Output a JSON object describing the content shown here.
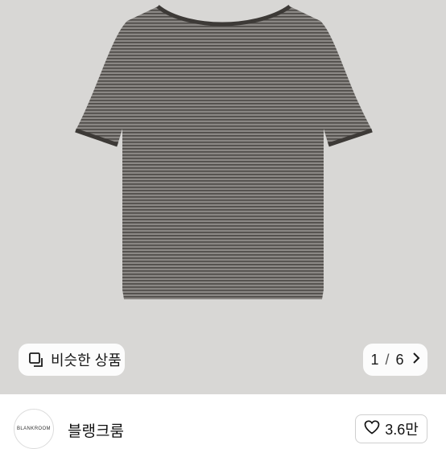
{
  "gallery": {
    "similar_label": "비슷한 상품",
    "similar_icon": "similar-items-icon",
    "current_page": "1",
    "separator": "/",
    "total_pages": "6",
    "next_icon": "chevron-right-icon"
  },
  "seller": {
    "logo_text": "BLANKROOM",
    "name": "블랭크룸",
    "likes": "3.6만",
    "like_icon": "heart-icon"
  },
  "colors": {
    "shirt": "#6e6b68",
    "trim": "#3d3a37",
    "background": "#d8d7d5"
  }
}
